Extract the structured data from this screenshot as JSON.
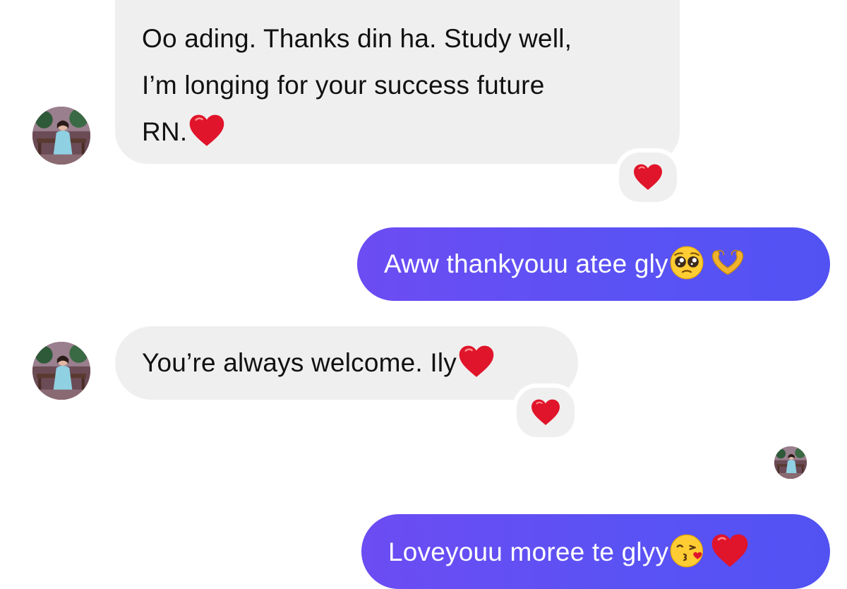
{
  "conversation": {
    "messages": [
      {
        "direction": "incoming",
        "lines": [
          "Oo ading. Thanks din ha. Study well,",
          "I’m longing for your success future",
          "RN."
        ],
        "trailing_emoji": "red-heart",
        "reaction": "red-heart"
      },
      {
        "direction": "outgoing",
        "text": "Aww thankyouu atee gly",
        "trailing_emojis": [
          "pleading-face",
          "heart-hands"
        ]
      },
      {
        "direction": "incoming",
        "text": "You’re always welcome. Ily",
        "trailing_emoji": "red-heart",
        "reaction": "red-heart"
      },
      {
        "direction": "outgoing",
        "text": "Loveyouu moree te glyy",
        "trailing_emojis": [
          "face-blowing-kiss",
          "red-heart"
        ]
      }
    ]
  },
  "colors": {
    "incoming_bubble": "#efefef",
    "outgoing_bubble_start": "#6c4cf3",
    "outgoing_bubble_end": "#5252f3",
    "heart": "#e0142a"
  }
}
